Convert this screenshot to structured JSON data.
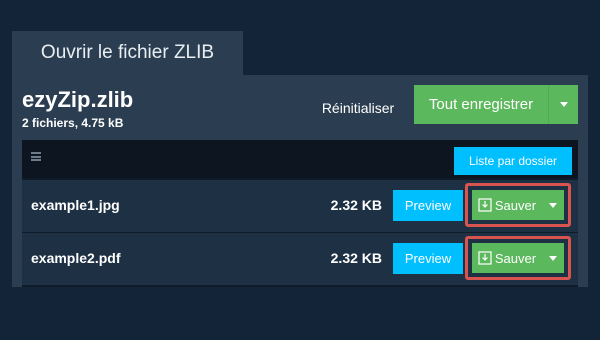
{
  "tab": {
    "title": "Ouvrir le fichier ZLIB"
  },
  "archive": {
    "name": "ezyZip.zlib",
    "meta": "2 fichiers, 4.75 kB"
  },
  "toolbar": {
    "reset_label": "Réinitialiser",
    "save_all_label": "Tout enregistrer"
  },
  "table": {
    "folder_view_label": "Liste par dossier",
    "rows": [
      {
        "name": "example1.jpg",
        "size": "2.32 KB",
        "preview_label": "Preview",
        "save_label": "Sauver"
      },
      {
        "name": "example2.pdf",
        "size": "2.32 KB",
        "preview_label": "Preview",
        "save_label": "Sauver"
      }
    ]
  },
  "colors": {
    "background": "#142438",
    "panel": "#2b3e51",
    "green": "#5cb85c",
    "cyan": "#00bfff",
    "highlight_border": "#d9534f"
  },
  "icons": {
    "menu": "hamburger-icon",
    "download": "download-icon",
    "caret": "caret-down-icon"
  }
}
